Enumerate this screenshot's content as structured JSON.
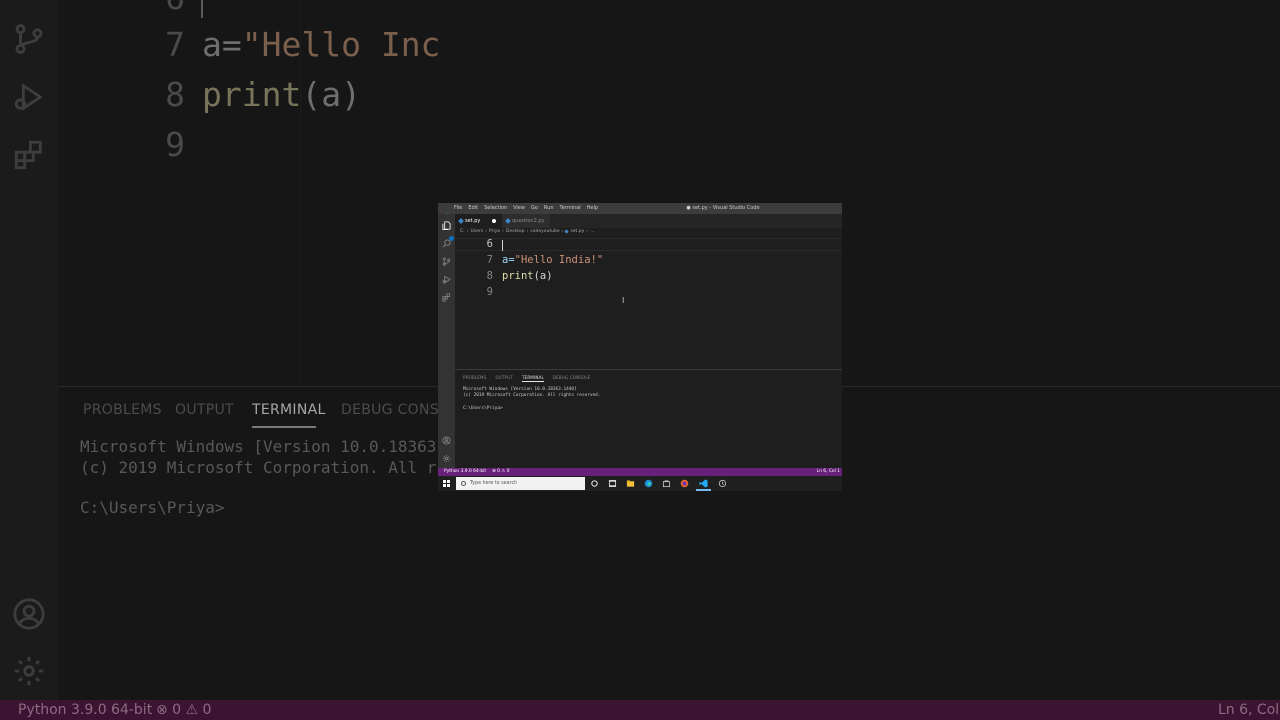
{
  "background": {
    "line_numbers": [
      "6",
      "7",
      "8",
      "9"
    ],
    "code_line7_var": "a=",
    "code_line7_str": "\"Hello Inc",
    "code_line8_fn": "print",
    "code_line8_rest": "(a)",
    "panel_tabs": [
      "PROBLEMS",
      "OUTPUT",
      "TERMINAL",
      "DEBUG CONSOL"
    ],
    "terminal_line1": "Microsoft Windows [Version 10.0.18363.1440]",
    "terminal_line2": "(c) 2019 Microsoft Corporation. All rights",
    "terminal_prompt": "C:\\Users\\Priya>",
    "status_python": "Python 3.9.0 64-bit",
    "status_problems": "⊗ 0 ⚠ 0",
    "status_position": "Ln 6, Col"
  },
  "window": {
    "title": "● set.py - Visual Studio Code",
    "menu": [
      "File",
      "Edit",
      "Selection",
      "View",
      "Go",
      "Run",
      "Terminal",
      "Help"
    ],
    "tabs": [
      {
        "label": "set.py",
        "active": true,
        "dirty": true
      },
      {
        "label": "question2.py",
        "active": false,
        "dirty": false
      }
    ],
    "breadcrumb": [
      "C:",
      "Users",
      "Priya",
      "Desktop",
      "codeyoutube",
      "set.py",
      "..."
    ],
    "editor": {
      "line_numbers": [
        "6",
        "7",
        "8",
        "9"
      ],
      "line7": {
        "var": "a=",
        "str": "\"Hello India!\""
      },
      "line8": {
        "fn": "print",
        "rest": "(a)"
      }
    },
    "panel": {
      "tabs": [
        "PROBLEMS",
        "OUTPUT",
        "TERMINAL",
        "DEBUG CONSOLE"
      ],
      "active_tab": "TERMINAL",
      "terminal_lines": [
        "Microsoft Windows [Version 10.0.18363.1440]",
        "(c) 2019 Microsoft Corporation. All rights reserved."
      ],
      "prompt": "C:\\Users\\Priya>"
    },
    "status": {
      "python": "Python 3.9.0 64-bit",
      "problems": "⊗ 0 ⚠ 0",
      "position": "Ln 6, Col 1"
    },
    "taskbar": {
      "search_placeholder": "Type here to search"
    }
  },
  "colors": {
    "status_bar": "#68217a",
    "editor_bg": "#1e1e1e",
    "string": "#ce9178",
    "function": "#dcdcaa",
    "variable": "#9cdcfe"
  }
}
